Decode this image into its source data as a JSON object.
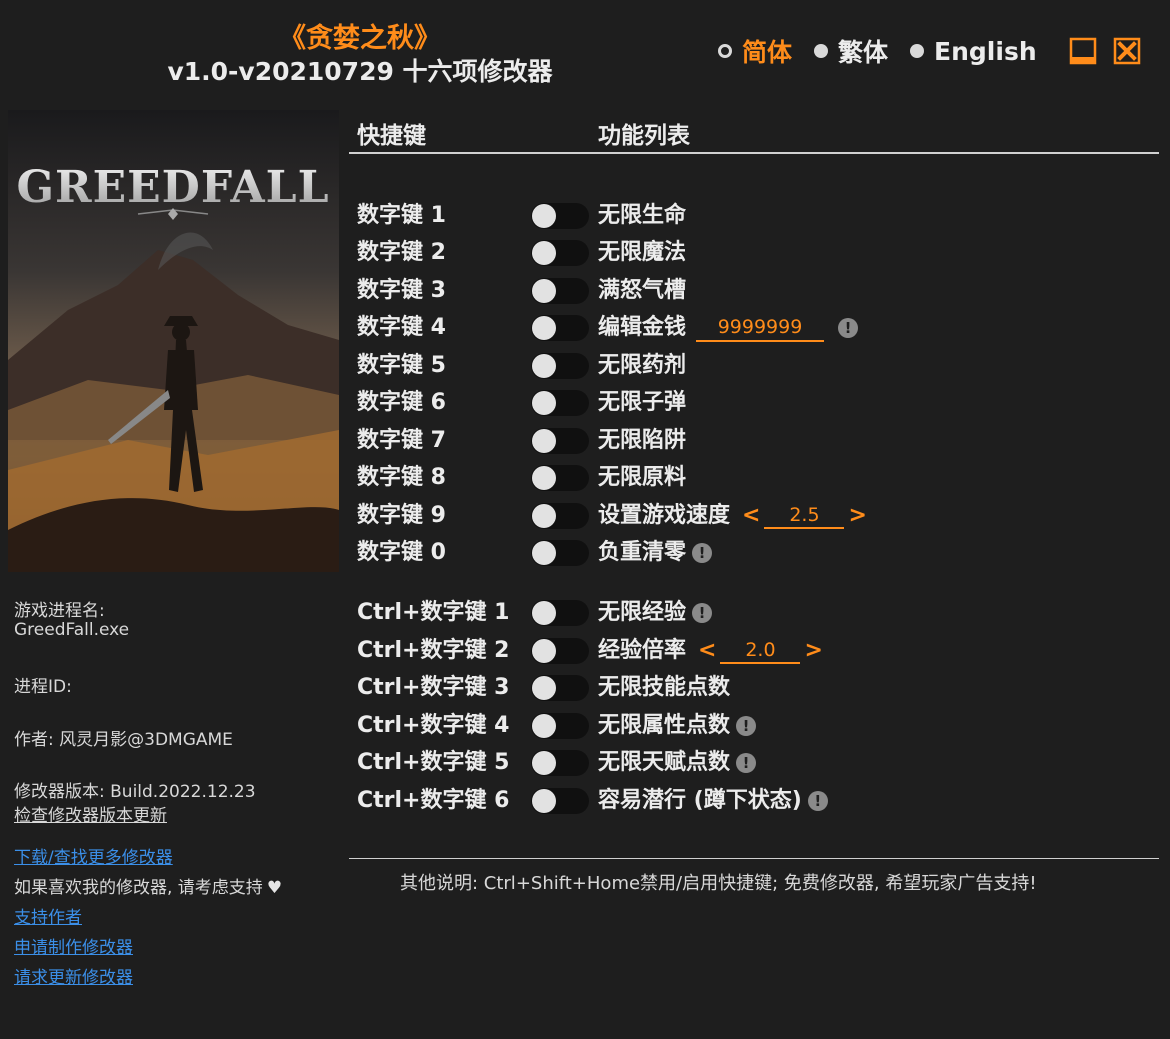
{
  "header": {
    "game_title": "《贪婪之秋》",
    "version_title": "v1.0-v20210729 十六项修改器"
  },
  "languages": [
    {
      "label": "简体",
      "selected": true
    },
    {
      "label": "繁体",
      "selected": false
    },
    {
      "label": "English",
      "selected": false
    }
  ],
  "colors": {
    "accent": "#ff8c1a",
    "background": "#1e1e1e",
    "link": "#3b8fe8"
  },
  "cover": {
    "logo_text": "GREEDFALL"
  },
  "info": {
    "process_name_label": "游戏进程名:",
    "process_name": "GreedFall.exe",
    "process_id_label": "进程ID:",
    "author": "作者:  风灵月影@3DMGAME",
    "trainer_version": "修改器版本:  Build.2022.12.23",
    "check_update": "检查修改器版本更新",
    "download_more": "下载/查找更多修改器",
    "support_text": "如果喜欢我的修改器, 请考虑支持",
    "support_author": "支持作者",
    "request_trainer": "申请制作修改器",
    "request_update": "请求更新修改器"
  },
  "table": {
    "col_hotkey": "快捷键",
    "col_function": "功能列表"
  },
  "cheats": [
    {
      "key": "数字键 1",
      "func": "无限生命",
      "warn": false
    },
    {
      "key": "数字键 2",
      "func": "无限魔法",
      "warn": false
    },
    {
      "key": "数字键 3",
      "func": "满怒气槽",
      "warn": false
    },
    {
      "key": "数字键 4",
      "func": "编辑金钱",
      "warn": true,
      "input": "9999999"
    },
    {
      "key": "数字键 5",
      "func": "无限药剂",
      "warn": false
    },
    {
      "key": "数字键 6",
      "func": "无限子弹",
      "warn": false
    },
    {
      "key": "数字键 7",
      "func": "无限陷阱",
      "warn": false
    },
    {
      "key": "数字键 8",
      "func": "无限原料",
      "warn": false
    },
    {
      "key": "数字键 9",
      "func": "设置游戏速度",
      "warn": false,
      "stepper": "2.5"
    },
    {
      "key": "数字键 0",
      "func": "负重清零",
      "warn": true
    },
    {
      "key": "Ctrl+数字键 1",
      "func": "无限经验",
      "warn": true
    },
    {
      "key": "Ctrl+数字键 2",
      "func": "经验倍率",
      "warn": false,
      "stepper": "2.0"
    },
    {
      "key": "Ctrl+数字键 3",
      "func": "无限技能点数",
      "warn": false
    },
    {
      "key": "Ctrl+数字键 4",
      "func": "无限属性点数",
      "warn": true
    },
    {
      "key": "Ctrl+数字键 5",
      "func": "无限天赋点数",
      "warn": true
    },
    {
      "key": "Ctrl+数字键 6",
      "func": "容易潜行 (蹲下状态)",
      "warn": true
    }
  ],
  "footer": {
    "note": "其他说明:  Ctrl+Shift+Home禁用/启用快捷键;  免费修改器,  希望玩家广告支持!"
  }
}
